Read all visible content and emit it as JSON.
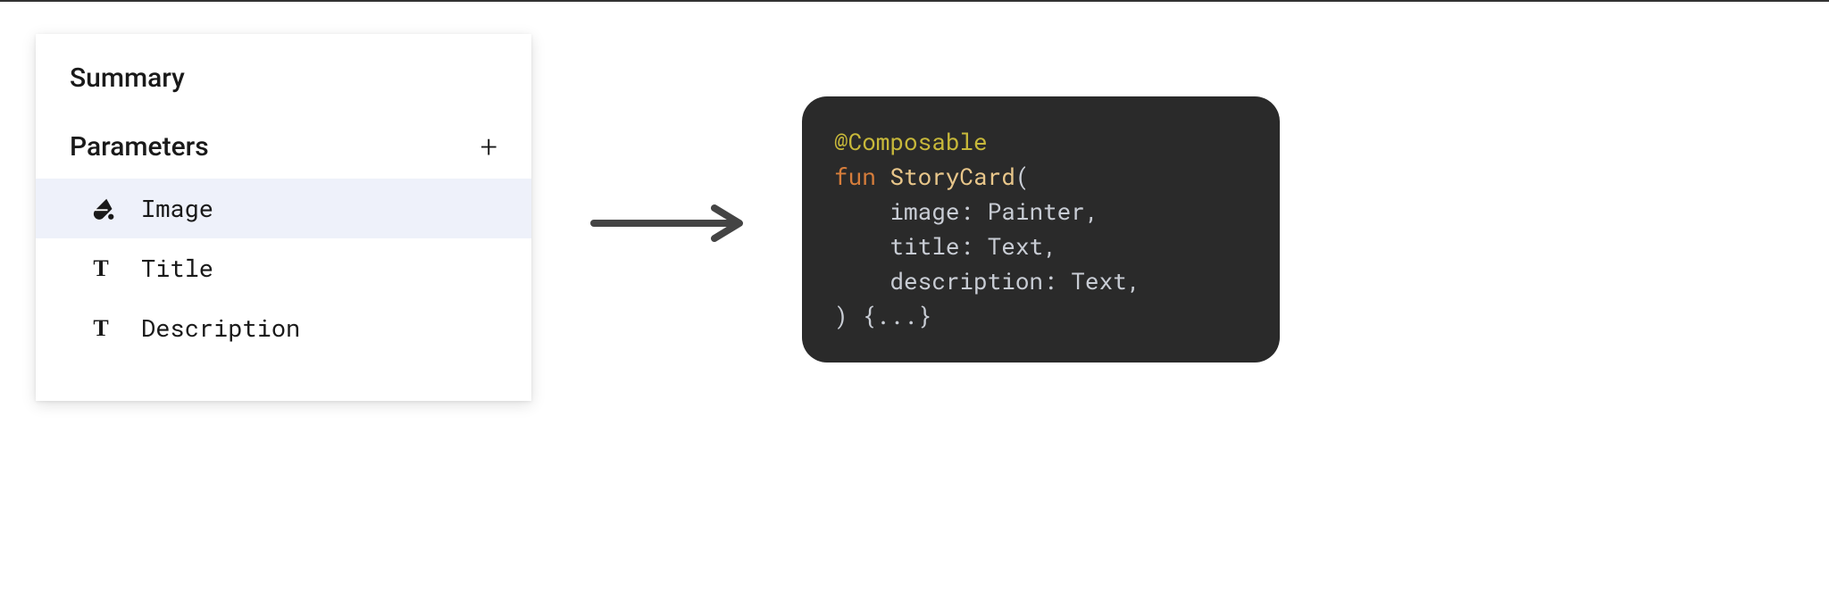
{
  "panel": {
    "title": "Summary",
    "section_label": "Parameters",
    "params": [
      {
        "icon": "fill-icon",
        "name": "Image",
        "selected": true
      },
      {
        "icon": "text-icon",
        "name": "Title",
        "selected": false
      },
      {
        "icon": "text-icon",
        "name": "Description",
        "selected": false
      }
    ]
  },
  "code": {
    "annotation": "@Composable",
    "keyword": "fun",
    "funcname": "StoryCard",
    "open": "(",
    "params": [
      {
        "name": "image",
        "type": "Painter"
      },
      {
        "name": "title",
        "type": "Text"
      },
      {
        "name": "description",
        "type": "Text"
      }
    ],
    "close_paren": ")",
    "body": "{...}"
  }
}
